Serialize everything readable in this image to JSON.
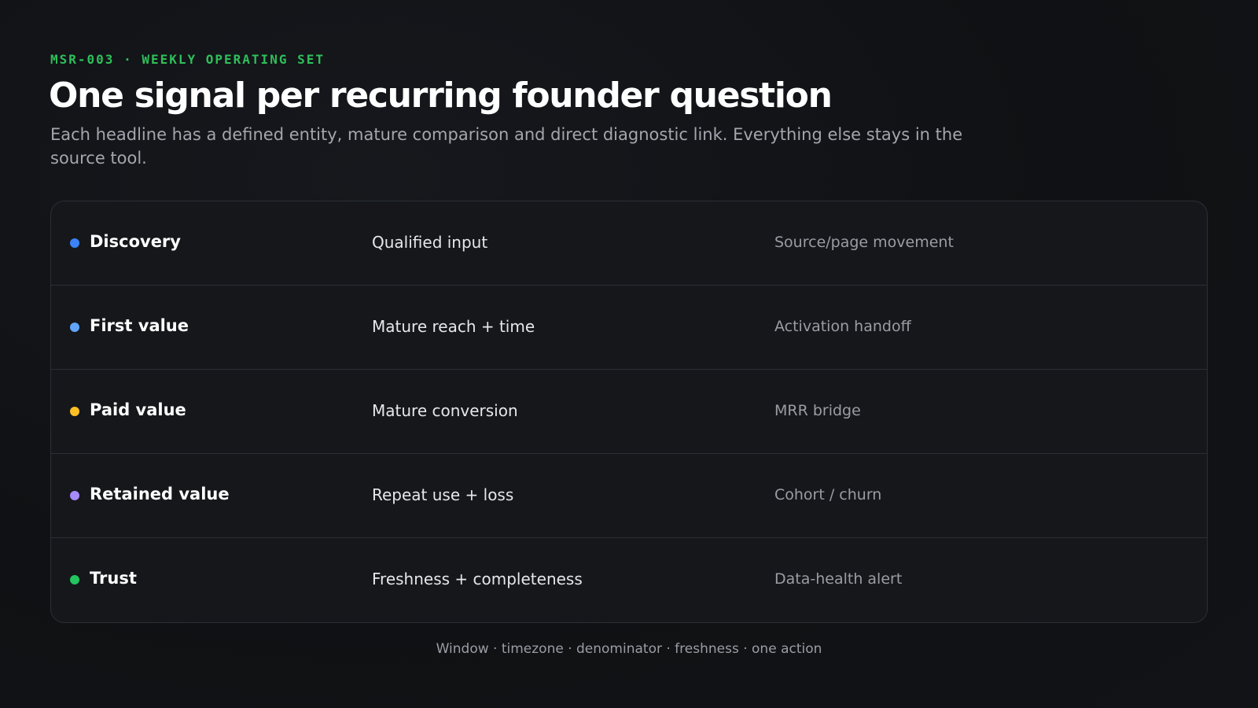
{
  "header": {
    "eyebrow": "MSR-003 · WEEKLY OPERATING SET",
    "title": "One signal per recurring founder question",
    "subtitle": "Each headline has a defined entity, mature comparison and direct diagnostic link. Everything else stays in the source tool."
  },
  "rows": [
    {
      "name": "Discovery",
      "signal": "Qualified input",
      "diagnostic": "Source/page movement",
      "color": "#3b82f6"
    },
    {
      "name": "First value",
      "signal": "Mature reach + time",
      "diagnostic": "Activation handoff",
      "color": "#60a5fa"
    },
    {
      "name": "Paid value",
      "signal": "Mature conversion",
      "diagnostic": "MRR bridge",
      "color": "#fbbf24"
    },
    {
      "name": "Retained value",
      "signal": "Repeat use + loss",
      "diagnostic": "Cohort / churn",
      "color": "#a78bfa"
    },
    {
      "name": "Trust",
      "signal": "Freshness + completeness",
      "diagnostic": "Data-health alert",
      "color": "#22c55e"
    }
  ],
  "footer": {
    "text": "Window · timezone · denominator · freshness · one action"
  }
}
